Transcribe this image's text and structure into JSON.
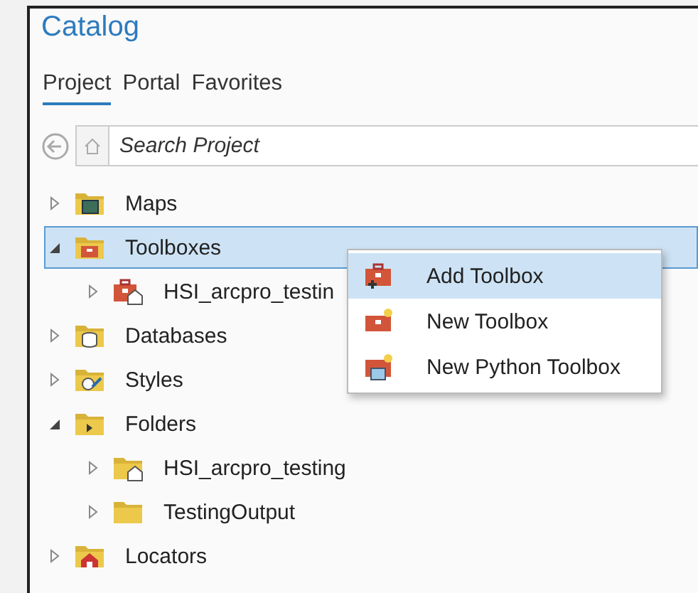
{
  "pane": {
    "title": "Catalog"
  },
  "tabs": [
    {
      "label": "Project",
      "selected": true
    },
    {
      "label": "Portal",
      "selected": false
    },
    {
      "label": "Favorites",
      "selected": false
    }
  ],
  "search": {
    "placeholder": "Search Project"
  },
  "tree": [
    {
      "label": "Maps",
      "kind": "maps",
      "expanded": false,
      "selected": false
    },
    {
      "label": "Toolboxes",
      "kind": "toolboxes",
      "expanded": true,
      "selected": true,
      "children": [
        {
          "label": "HSI_arcpro_testin",
          "kind": "toolbox",
          "expanded": false,
          "selected": false
        }
      ]
    },
    {
      "label": "Databases",
      "kind": "databases",
      "expanded": false,
      "selected": false
    },
    {
      "label": "Styles",
      "kind": "styles",
      "expanded": false,
      "selected": false
    },
    {
      "label": "Folders",
      "kind": "folders",
      "expanded": true,
      "selected": false,
      "children": [
        {
          "label": "HSI_arcpro_testing",
          "kind": "homefolder",
          "expanded": false,
          "selected": false
        },
        {
          "label": "TestingOutput",
          "kind": "folder",
          "expanded": false,
          "selected": false
        }
      ]
    },
    {
      "label": "Locators",
      "kind": "locators",
      "expanded": false,
      "selected": false
    }
  ],
  "context_menu": [
    {
      "label": "Add Toolbox",
      "kind": "add",
      "selected": true
    },
    {
      "label": "New Toolbox",
      "kind": "new",
      "selected": false
    },
    {
      "label": "New Python Toolbox",
      "kind": "python",
      "selected": false
    }
  ]
}
